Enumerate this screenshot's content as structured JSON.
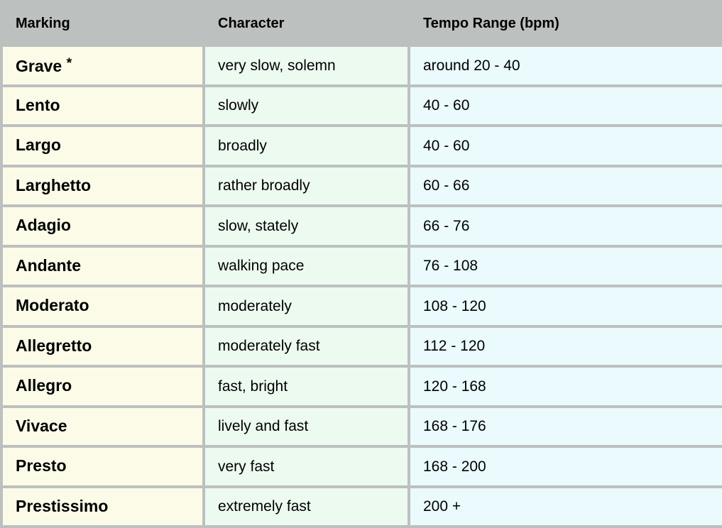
{
  "table": {
    "columns": [
      {
        "key": "marking",
        "label": "Marking"
      },
      {
        "key": "character",
        "label": "Character"
      },
      {
        "key": "tempo",
        "label": "Tempo Range (bpm)"
      }
    ],
    "rows": [
      {
        "marking": "Grave",
        "footnote": "*",
        "character": "very slow, solemn",
        "tempo": "around 20 - 40"
      },
      {
        "marking": "Lento",
        "footnote": "",
        "character": "slowly",
        "tempo": "40 - 60"
      },
      {
        "marking": "Largo",
        "footnote": "",
        "character": "broadly",
        "tempo": "40 - 60"
      },
      {
        "marking": "Larghetto",
        "footnote": "",
        "character": "rather broadly",
        "tempo": "60 - 66"
      },
      {
        "marking": "Adagio",
        "footnote": "",
        "character": "slow, stately",
        "tempo": "66 - 76"
      },
      {
        "marking": "Andante",
        "footnote": "",
        "character": "walking pace",
        "tempo": "76 - 108"
      },
      {
        "marking": "Moderato",
        "footnote": "",
        "character": "moderately",
        "tempo": "108 - 120"
      },
      {
        "marking": "Allegretto",
        "footnote": "",
        "character": "moderately fast",
        "tempo": "112 - 120"
      },
      {
        "marking": "Allegro",
        "footnote": "",
        "character": "fast, bright",
        "tempo": "120 - 168"
      },
      {
        "marking": "Vivace",
        "footnote": "",
        "character": "lively and fast",
        "tempo": "168 - 176"
      },
      {
        "marking": "Presto",
        "footnote": "",
        "character": "very fast",
        "tempo": "168 - 200"
      },
      {
        "marking": "Prestissimo",
        "footnote": "",
        "character": "extremely fast",
        "tempo": "200 +"
      }
    ]
  },
  "colors": {
    "grid": "#bcc0bf",
    "header_background": "#bcc0bf",
    "marking_background": "#fbfbe8",
    "character_background": "#edfaf0",
    "tempo_background": "#eafafd",
    "text": "#000000"
  }
}
